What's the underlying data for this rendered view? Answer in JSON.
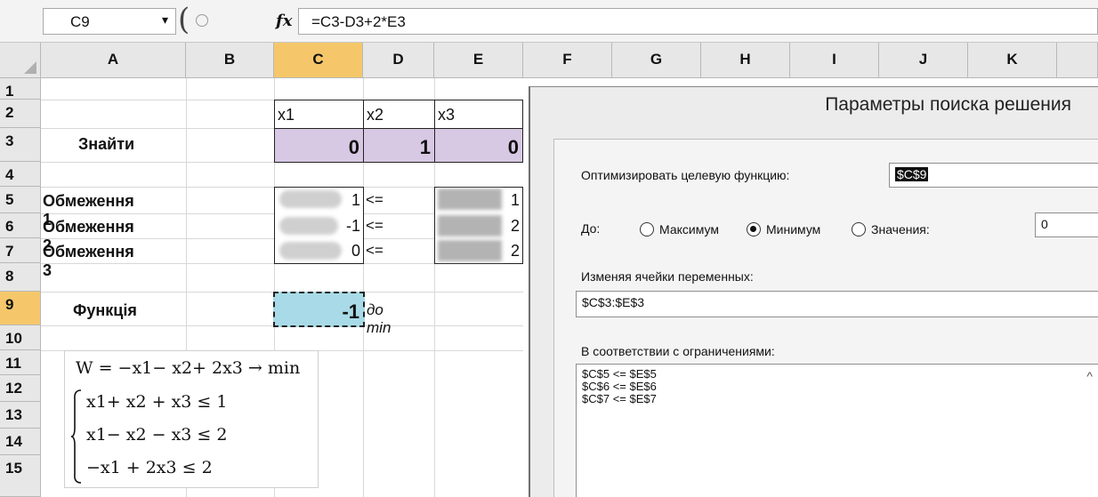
{
  "formula_bar": {
    "name_box": "C9",
    "fx": "fx",
    "formula": "=C3-D3+2*E3"
  },
  "columns": [
    "A",
    "B",
    "C",
    "D",
    "E",
    "F",
    "G",
    "H",
    "I",
    "J",
    "K"
  ],
  "rows": [
    "1",
    "2",
    "3",
    "4",
    "5",
    "6",
    "7",
    "8",
    "9",
    "10",
    "11",
    "12",
    "13",
    "14",
    "15"
  ],
  "cells": {
    "x1": "x1",
    "x2": "x2",
    "x3": "x3",
    "find_label": "Знайти",
    "c3": "0",
    "d3": "1",
    "e3": "0",
    "constraint1": "Обмеження 1",
    "constraint2": "Обмеження 2",
    "constraint3": "Обмеження 3",
    "c5": "1",
    "c6": "-1",
    "c7": "0",
    "d5": "<=",
    "d6": "<=",
    "d7": "<=",
    "e5": "1",
    "e6": "2",
    "e7": "2",
    "function_label": "Функція",
    "c9": "-1",
    "d9": "до min"
  },
  "math": {
    "objective": "W = −x1− x2+ 2x3 → min",
    "c1": "x1+ x2 + x3 ≤ 1",
    "c2": "x1− x2 − x3 ≤ 2",
    "c3": "−x1 + 2x3 ≤ 2"
  },
  "solver": {
    "title": "Параметры поиска решения",
    "objective_label": "Оптимизировать целевую функцию:",
    "objective_value": "$C$9",
    "to_label": "До:",
    "max": "Максимум",
    "min": "Минимум",
    "value_of": "Значения:",
    "value_input": "0",
    "changing_label": "Изменяя ячейки переменных:",
    "changing_value": "$C$3:$E$3",
    "subject_label": "В соответствии с ограничениями:",
    "constraints": [
      "$C$5 <= $E$5",
      "$C$6 <= $E$6",
      "$C$7 <= $E$7"
    ]
  }
}
